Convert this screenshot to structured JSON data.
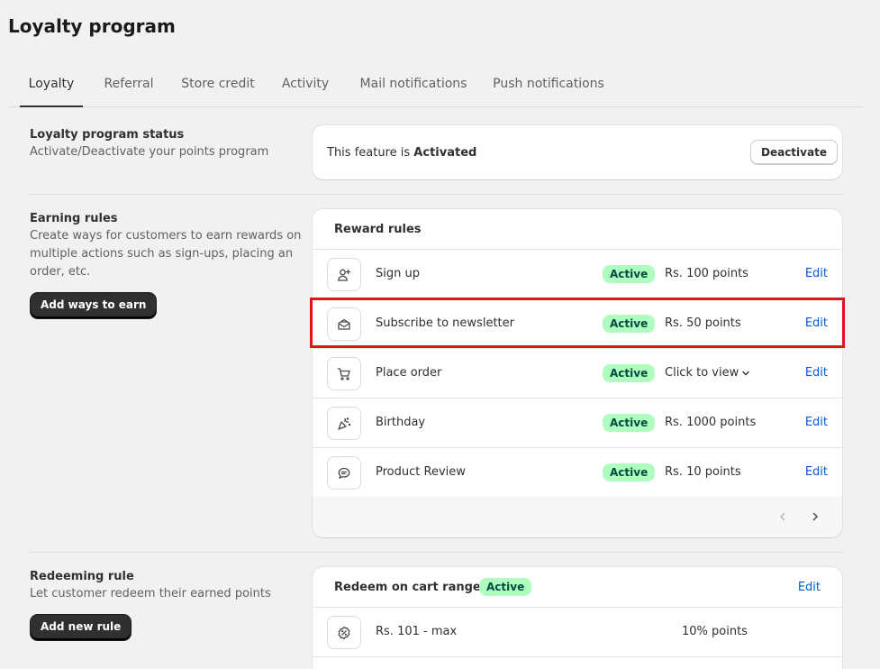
{
  "page": {
    "title": "Loyalty program"
  },
  "tabs": [
    {
      "label": "Loyalty",
      "active": true
    },
    {
      "label": "Referral",
      "active": false
    },
    {
      "label": "Store credit",
      "active": false
    },
    {
      "label": "Activity",
      "active": false
    },
    {
      "label": "Mail notifications",
      "active": false
    },
    {
      "label": "Push notifications",
      "active": false
    }
  ],
  "status_section": {
    "title": "Loyalty program status",
    "description": "Activate/Deactivate your points program",
    "status_prefix": "This feature is",
    "status_value": "Activated",
    "button_label": "Deactivate"
  },
  "earning_section": {
    "title": "Earning rules",
    "description_lines": [
      "Create ways for customers to earn rewards on",
      "multiple actions such as sign-ups, placing an",
      "order, etc."
    ],
    "button_label": "Add ways to earn",
    "card_title": "Reward rules",
    "rules": [
      {
        "name": "Sign up",
        "icon": "user-plus-icon",
        "status": "Active",
        "value": "Rs. 100 points",
        "edit": "Edit"
      },
      {
        "name": "Subscribe to newsletter",
        "icon": "mail-open-icon",
        "status": "Active",
        "value": "Rs. 50 points",
        "edit": "Edit"
      },
      {
        "name": "Place order",
        "icon": "cart-icon",
        "status": "Active",
        "value": "Click to view",
        "edit": "Edit"
      },
      {
        "name": "Birthday",
        "icon": "party-icon",
        "status": "Active",
        "value": "Rs. 1000 points",
        "edit": "Edit"
      },
      {
        "name": "Product Review",
        "icon": "chat-icon",
        "status": "Active",
        "value": "Rs. 10 points",
        "edit": "Edit"
      }
    ]
  },
  "redeeming_section": {
    "title": "Redeeming rule",
    "description": "Let customer redeem their earned points",
    "button_label": "Add new rule",
    "card_title": "Redeem on cart ranges",
    "status": "Active",
    "edit": "Edit",
    "range": {
      "icon": "percent-badge-icon",
      "label": "Rs. 101 - max",
      "value": "10% points"
    }
  },
  "colors": {
    "active_badge_bg": "#affebf",
    "active_badge_text": "#014b40",
    "link": "#005bd3",
    "highlight": "#e0141d"
  }
}
